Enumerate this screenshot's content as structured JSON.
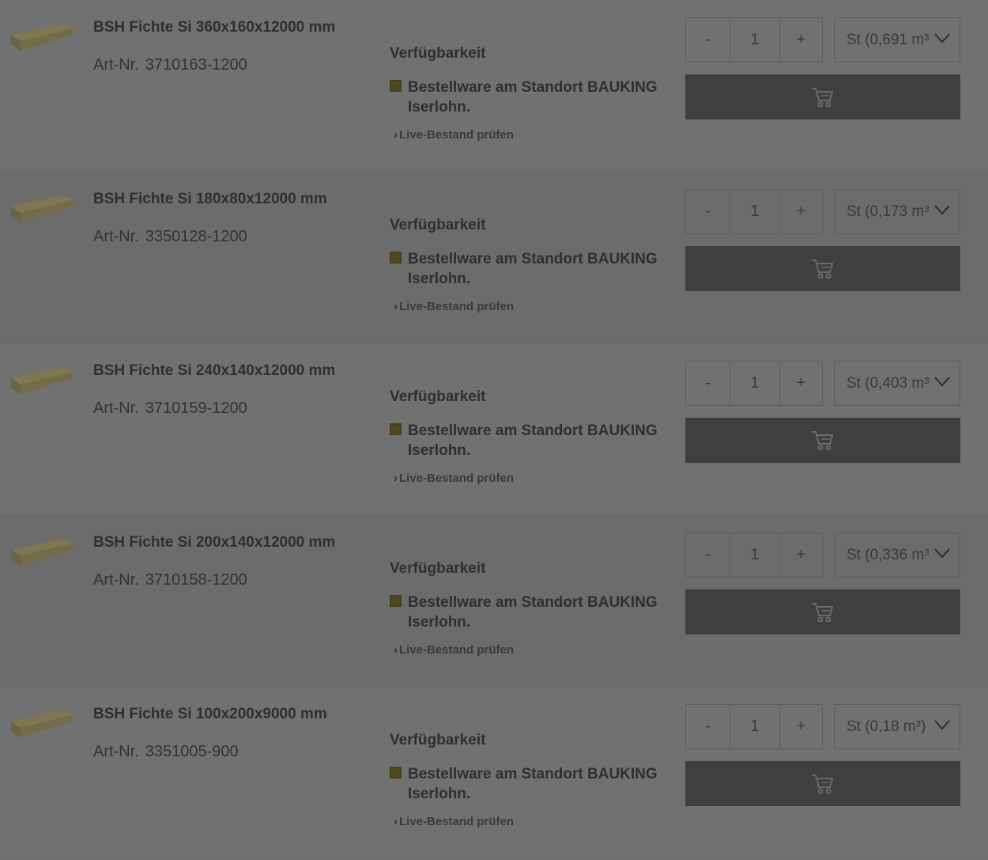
{
  "products": [
    {
      "title": "BSH Fichte Si 360x160x12000 mm",
      "art_label": "Art-Nr.",
      "art_nr": "3710163-1200",
      "availability_heading": "Verfügbarkeit",
      "availability_status": "Bestellware am Standort BAUKING Iserlohn.",
      "live_link": "Live-Bestand prüfen",
      "qty_minus": "-",
      "qty_value": "1",
      "qty_plus": "+",
      "unit": "St (0,691 m³"
    },
    {
      "title": "BSH Fichte Si 180x80x12000 mm",
      "art_label": "Art-Nr.",
      "art_nr": "3350128-1200",
      "availability_heading": "Verfügbarkeit",
      "availability_status": "Bestellware am Standort BAUKING Iserlohn.",
      "live_link": "Live-Bestand prüfen",
      "qty_minus": "-",
      "qty_value": "1",
      "qty_plus": "+",
      "unit": "St (0,173 m³"
    },
    {
      "title": "BSH Fichte Si 240x140x12000 mm",
      "art_label": "Art-Nr.",
      "art_nr": "3710159-1200",
      "availability_heading": "Verfügbarkeit",
      "availability_status": "Bestellware am Standort BAUKING Iserlohn.",
      "live_link": "Live-Bestand prüfen",
      "qty_minus": "-",
      "qty_value": "1",
      "qty_plus": "+",
      "unit": "St (0,403 m³"
    },
    {
      "title": "BSH Fichte Si 200x140x12000 mm",
      "art_label": "Art-Nr.",
      "art_nr": "3710158-1200",
      "availability_heading": "Verfügbarkeit",
      "availability_status": "Bestellware am Standort BAUKING Iserlohn.",
      "live_link": "Live-Bestand prüfen",
      "qty_minus": "-",
      "qty_value": "1",
      "qty_plus": "+",
      "unit": "St (0,336 m³"
    },
    {
      "title": "BSH Fichte Si 100x200x9000 mm",
      "art_label": "Art-Nr.",
      "art_nr": "3351005-900",
      "availability_heading": "Verfügbarkeit",
      "availability_status": "Bestellware am Standort BAUKING Iserlohn.",
      "live_link": "Live-Bestand prüfen",
      "qty_minus": "-",
      "qty_value": "1",
      "qty_plus": "+",
      "unit": "St (0,18 m³)"
    }
  ],
  "icons": {
    "product_image": "wood-beam-icon",
    "status": "availability-status-icon",
    "caret": "chevron-down-icon",
    "cart": "cart-icon",
    "link_chevron": "chevron-right-icon"
  },
  "colors": {
    "overlay_bg": "#6e6e6e",
    "cart_button": "#3f3f3f",
    "status_square": "#4d4a22",
    "link_chevron": "#5a2020"
  }
}
